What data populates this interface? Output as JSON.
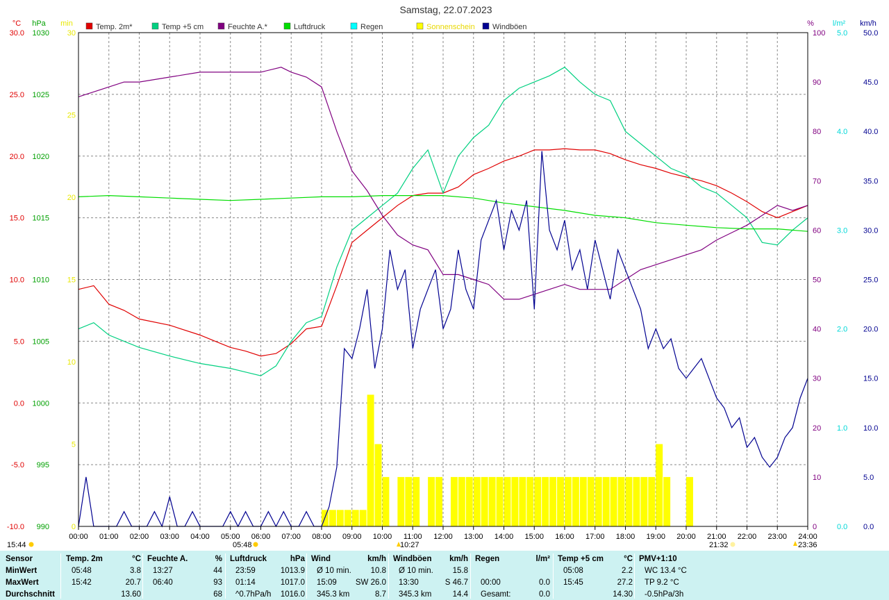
{
  "title": "Samstag, 22.07.2023",
  "legend": [
    {
      "label": "Temp. 2m*",
      "color": "#e00000"
    },
    {
      "label": "Temp +5 cm",
      "color": "#00d080"
    },
    {
      "label": "Feuchte A.*",
      "color": "#800080"
    },
    {
      "label": "Luftdruck",
      "color": "#00dd00"
    },
    {
      "label": "Regen",
      "color": "#00ffff"
    },
    {
      "label": "Sonnenschein",
      "color": "#ffff00"
    },
    {
      "label": "Windböen",
      "color": "#000090"
    }
  ],
  "colors": {
    "temp2m": "#e00000",
    "temp5cm": "#00d080",
    "humidity": "#800080",
    "pressure": "#00dd00",
    "rain": "#00dddd",
    "sun": "#ffff00",
    "gusts": "#000090"
  },
  "chart_data": {
    "type": "line",
    "title": "Samstag, 22.07.2023",
    "x_ticks": [
      "00:00",
      "01:00",
      "02:00",
      "03:00",
      "04:00",
      "05:00",
      "06:00",
      "07:00",
      "08:00",
      "09:00",
      "10:00",
      "11:00",
      "12:00",
      "13:00",
      "14:00",
      "15:00",
      "16:00",
      "17:00",
      "18:00",
      "19:00",
      "20:00",
      "21:00",
      "22:00",
      "23:00",
      "24:00"
    ],
    "xlim": [
      0,
      24
    ],
    "grid": true,
    "axes": {
      "temp": {
        "unit": "°C",
        "range": [
          -10,
          30
        ],
        "ticks": [
          "-10.0",
          "-5.0",
          "0.0",
          "5.0",
          "10.0",
          "15.0",
          "20.0",
          "25.0",
          "30.0"
        ]
      },
      "pressure": {
        "unit": "hPa",
        "range": [
          990,
          1030
        ],
        "ticks": [
          "990",
          "995",
          "1000",
          "1005",
          "1010",
          "1015",
          "1020",
          "1025",
          "1030"
        ]
      },
      "sun": {
        "unit": "min",
        "range": [
          0,
          30
        ],
        "ticks": [
          "0",
          "5",
          "10",
          "15",
          "20",
          "25",
          "30"
        ]
      },
      "humidity": {
        "unit": "%",
        "range": [
          0,
          100
        ],
        "ticks": [
          "0",
          "10",
          "20",
          "30",
          "40",
          "50",
          "60",
          "70",
          "80",
          "90",
          "100"
        ]
      },
      "rain": {
        "unit": "l/m²",
        "range": [
          0,
          5
        ],
        "ticks": [
          "0.0",
          "1.0",
          "2.0",
          "3.0",
          "4.0",
          "5.0"
        ]
      },
      "wind": {
        "unit": "km/h",
        "range": [
          0,
          50
        ],
        "ticks": [
          "0.0",
          "5.0",
          "10.0",
          "15.0",
          "20.0",
          "25.0",
          "30.0",
          "35.0",
          "40.0",
          "45.0",
          "50.0"
        ]
      }
    },
    "series": [
      {
        "name": "Temp. 2m*",
        "axis": "temp",
        "x": [
          0,
          0.5,
          1,
          1.5,
          2,
          3,
          4,
          4.5,
          5,
          5.5,
          6,
          6.5,
          7,
          7.5,
          8,
          8.5,
          9,
          9.5,
          10,
          10.5,
          11,
          11.5,
          12,
          12.5,
          13,
          13.5,
          14,
          14.5,
          15,
          15.5,
          16,
          16.5,
          17,
          17.5,
          18,
          18.5,
          19,
          19.5,
          20,
          20.5,
          21,
          21.5,
          22,
          22.5,
          23,
          23.5,
          24
        ],
        "y": [
          9.2,
          9.5,
          8.0,
          7.5,
          6.8,
          6.3,
          5.5,
          5.0,
          4.5,
          4.2,
          3.8,
          4.0,
          4.8,
          6.0,
          6.2,
          9.5,
          13.0,
          14.0,
          15.0,
          16.0,
          16.8,
          17.0,
          17.0,
          17.5,
          18.5,
          19.0,
          19.6,
          20.0,
          20.5,
          20.5,
          20.6,
          20.5,
          20.5,
          20.2,
          19.7,
          19.3,
          19.0,
          18.6,
          18.3,
          18.0,
          17.6,
          17.0,
          16.3,
          15.5,
          15.0,
          15.5,
          16.0
        ]
      },
      {
        "name": "Temp +5 cm",
        "axis": "temp",
        "x": [
          0,
          0.5,
          1,
          1.5,
          2,
          3,
          4,
          5,
          5.5,
          6,
          6.5,
          7,
          7.5,
          8,
          8.5,
          9,
          9.5,
          10,
          10.5,
          11,
          11.5,
          12,
          12.5,
          13,
          13.5,
          14,
          14.5,
          15,
          15.5,
          16,
          16.5,
          17,
          17.5,
          18,
          18.5,
          19,
          19.5,
          20,
          20.5,
          21,
          21.5,
          22,
          22.5,
          23,
          23.5,
          24
        ],
        "y": [
          6.0,
          6.5,
          5.5,
          5.0,
          4.5,
          3.8,
          3.2,
          2.8,
          2.5,
          2.2,
          3.0,
          5.0,
          6.5,
          7.0,
          11.0,
          14.0,
          15.0,
          16.0,
          17.0,
          19.0,
          20.5,
          17.0,
          20.0,
          21.5,
          22.5,
          24.5,
          25.5,
          26.0,
          26.5,
          27.2,
          26.0,
          25.0,
          24.5,
          22.0,
          21.0,
          20.0,
          19.0,
          18.5,
          17.5,
          17.0,
          16.0,
          15.0,
          13.0,
          12.8,
          14.0,
          15.0
        ]
      },
      {
        "name": "Feuchte A.*",
        "axis": "humidity",
        "x": [
          0,
          0.5,
          1,
          1.5,
          2,
          3,
          4,
          5,
          6,
          6.67,
          7,
          7.5,
          8,
          8.5,
          9,
          9.5,
          10,
          10.5,
          11,
          11.5,
          12,
          12.5,
          13,
          13.5,
          14,
          14.5,
          15,
          15.5,
          16,
          16.5,
          17,
          17.5,
          18,
          18.5,
          19,
          19.5,
          20,
          20.5,
          21,
          21.5,
          22,
          22.5,
          23,
          23.5,
          24
        ],
        "y": [
          87,
          88,
          89,
          90,
          90,
          91,
          92,
          92,
          92,
          93,
          92,
          91,
          89,
          80,
          72,
          68,
          63,
          59,
          57,
          56,
          51,
          51,
          50,
          49,
          46,
          46,
          47,
          48,
          49,
          48,
          48,
          48,
          50,
          52,
          53,
          54,
          55,
          56,
          58,
          59.5,
          61,
          63,
          65,
          64,
          65
        ]
      },
      {
        "name": "Luftdruck",
        "axis": "pressure",
        "x": [
          0,
          1,
          2,
          3,
          4,
          5,
          6,
          7,
          8,
          9,
          10,
          11,
          12,
          13,
          14,
          15,
          16,
          17,
          18,
          19,
          20,
          21,
          22,
          23,
          24
        ],
        "y": [
          1016.7,
          1016.8,
          1016.7,
          1016.6,
          1016.5,
          1016.4,
          1016.5,
          1016.6,
          1016.7,
          1016.7,
          1016.8,
          1016.8,
          1016.8,
          1016.6,
          1016.2,
          1015.9,
          1015.6,
          1015.2,
          1015.0,
          1014.6,
          1014.4,
          1014.2,
          1014.1,
          1014.1,
          1013.9
        ]
      },
      {
        "name": "Windböen",
        "axis": "wind",
        "x": [
          0,
          0.25,
          0.5,
          0.75,
          1,
          1.25,
          1.5,
          1.75,
          2,
          2.25,
          2.5,
          2.75,
          3,
          3.25,
          3.5,
          3.75,
          4,
          4.25,
          4.5,
          4.75,
          5,
          5.25,
          5.5,
          5.75,
          6,
          6.25,
          6.5,
          6.75,
          7,
          7.25,
          7.5,
          7.75,
          8,
          8.25,
          8.5,
          8.75,
          9,
          9.25,
          9.5,
          9.75,
          10,
          10.25,
          10.5,
          10.75,
          11,
          11.25,
          11.5,
          11.75,
          12,
          12.25,
          12.5,
          12.75,
          13,
          13.25,
          13.5,
          13.75,
          14,
          14.25,
          14.5,
          14.75,
          15,
          15.25,
          15.5,
          15.75,
          16,
          16.25,
          16.5,
          16.75,
          17,
          17.25,
          17.5,
          17.75,
          18,
          18.25,
          18.5,
          18.75,
          19,
          19.25,
          19.5,
          19.75,
          20,
          20.25,
          20.5,
          20.75,
          21,
          21.25,
          21.5,
          21.75,
          22,
          22.25,
          22.5,
          22.75,
          23,
          23.25,
          23.5,
          23.75,
          24
        ],
        "y": [
          0,
          5,
          0,
          0,
          0,
          0,
          1.5,
          0,
          0,
          0,
          1.5,
          0,
          3,
          0,
          0,
          1.5,
          0,
          0,
          0,
          0,
          1.5,
          0,
          1.5,
          0,
          0,
          1.5,
          0,
          1.5,
          0,
          0,
          1.5,
          0,
          0,
          2,
          6,
          18,
          17,
          20,
          24,
          16,
          20,
          28,
          24,
          26,
          18,
          22,
          24,
          26,
          20,
          22,
          28,
          24,
          22,
          29,
          31,
          33,
          28,
          32,
          30,
          33,
          22,
          38,
          30,
          28,
          31,
          26,
          28,
          24,
          29,
          26,
          23,
          28,
          26,
          24,
          22,
          18,
          20,
          18,
          19,
          16,
          15,
          16,
          17,
          15,
          13,
          12,
          10,
          11,
          8,
          9,
          7,
          6,
          7,
          9,
          10,
          13,
          15
        ]
      },
      {
        "name": "Sonnenschein",
        "axis": "sun",
        "type": "bar",
        "x": [
          8,
          8.25,
          8.5,
          8.75,
          9,
          9.25,
          9.5,
          9.75,
          10,
          10.25,
          10.5,
          10.75,
          11,
          11.25,
          11.5,
          11.75,
          12,
          12.25,
          12.5,
          12.75,
          13,
          13.25,
          13.5,
          13.75,
          14,
          14.25,
          14.5,
          14.75,
          15,
          15.25,
          15.5,
          15.75,
          16,
          16.25,
          16.5,
          16.75,
          17,
          17.25,
          17.5,
          17.75,
          18,
          18.25,
          18.5,
          18.75,
          19,
          19.25,
          19.5,
          19.75,
          20,
          20.25,
          20.5,
          20.75,
          21,
          21.25,
          21.5
        ],
        "y": [
          1,
          1,
          1,
          1,
          1,
          1,
          8,
          5,
          3,
          0,
          3,
          3,
          3,
          0,
          3,
          3,
          0,
          3,
          3,
          3,
          3,
          3,
          3,
          3,
          3,
          3,
          3,
          3,
          3,
          3,
          3,
          3,
          3,
          3,
          3,
          3,
          3,
          3,
          3,
          3,
          3,
          3,
          3,
          3,
          5,
          3,
          0,
          0,
          3,
          0,
          0,
          0,
          0,
          0,
          0
        ]
      }
    ]
  },
  "chart_labels": {
    "sunrise": "05:48",
    "sunset": "21:32",
    "left_time": "15:44",
    "mid_time": "10:27",
    "right_time": "23:36"
  },
  "table": {
    "headers": [
      {
        "label": "Sensor",
        "unit": ""
      },
      {
        "label": "Temp. 2m",
        "unit": "°C"
      },
      {
        "label": "Feuchte A.",
        "unit": "%"
      },
      {
        "label": "Luftdruck",
        "unit": "hPa"
      },
      {
        "label": "Wind",
        "unit": "km/h"
      },
      {
        "label": "Windböen",
        "unit": "km/h"
      },
      {
        "label": "Regen",
        "unit": "l/m²"
      },
      {
        "label": "Temp +5 cm",
        "unit": "°C"
      },
      {
        "label": "PMV+1:10",
        "unit": ""
      }
    ],
    "rows": [
      {
        "label": "MinWert",
        "cells": [
          [
            "05:48",
            "3.8"
          ],
          [
            "13:27",
            "44"
          ],
          [
            "23:59",
            "1013.9"
          ],
          [
            "Ø 10 min.",
            "10.8"
          ],
          [
            "Ø 10 min.",
            "15.8"
          ],
          [
            "",
            ""
          ],
          [
            "05:08",
            "2.2"
          ],
          [
            "WC 13.4 °C",
            ""
          ]
        ]
      },
      {
        "label": "MaxWert",
        "cells": [
          [
            "15:42",
            "20.7"
          ],
          [
            "06:40",
            "93"
          ],
          [
            "01:14",
            "1017.0"
          ],
          [
            "15:09",
            "SW 26.0"
          ],
          [
            "13:30",
            "S 46.7"
          ],
          [
            "00:00",
            "0.0"
          ],
          [
            "15:45",
            "27.2"
          ],
          [
            "TP 9.2 °C",
            ""
          ]
        ]
      },
      {
        "label": "Durchschnitt",
        "cells": [
          [
            "",
            "13.60"
          ],
          [
            "",
            "68"
          ],
          [
            "^0.7hPa/h",
            "1016.0"
          ],
          [
            "345.3 km",
            "8.7"
          ],
          [
            "345.3 km",
            "14.4"
          ],
          [
            "Gesamt:",
            "0.0"
          ],
          [
            "",
            "14.30"
          ],
          [
            "-0.5hPa/3h",
            ""
          ]
        ]
      }
    ]
  }
}
